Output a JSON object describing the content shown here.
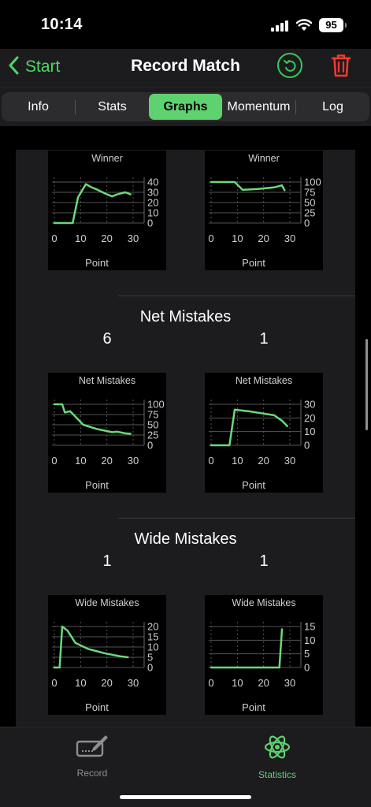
{
  "status": {
    "time": "10:14",
    "battery": "95"
  },
  "nav": {
    "back_label": "Start",
    "title": "Record Match"
  },
  "tabs": [
    {
      "label": "Info",
      "selected": false
    },
    {
      "label": "Stats",
      "selected": false
    },
    {
      "label": "Graphs",
      "selected": true
    },
    {
      "label": "Momentum",
      "selected": false
    },
    {
      "label": "Log",
      "selected": false
    }
  ],
  "sections": [
    {
      "id": "winner",
      "title": "",
      "values": [
        "",
        ""
      ],
      "charts": [
        {
          "title": "Winner",
          "xlabel": "Point",
          "xticks": [
            0,
            10,
            20,
            30
          ],
          "yticks": [
            0,
            10,
            20,
            30,
            40
          ],
          "ymax": 40,
          "x": [
            0,
            7,
            9,
            12,
            14,
            16,
            20,
            22,
            24,
            27,
            29
          ],
          "y": [
            0,
            0,
            25,
            38,
            35,
            33,
            28,
            26,
            28,
            30,
            28
          ]
        },
        {
          "title": "Winner",
          "xlabel": "Point",
          "xticks": [
            0,
            10,
            20,
            30
          ],
          "yticks": [
            0,
            25,
            50,
            75,
            100
          ],
          "ymax": 100,
          "x": [
            0,
            6,
            9,
            12,
            18,
            24,
            27,
            28
          ],
          "y": [
            100,
            100,
            100,
            81,
            83,
            87,
            92,
            80
          ]
        }
      ]
    },
    {
      "id": "net-mistakes",
      "title": "Net Mistakes",
      "values": [
        "6",
        "1"
      ],
      "charts": [
        {
          "title": "Net Mistakes",
          "xlabel": "Point",
          "xticks": [
            0,
            10,
            20,
            30
          ],
          "yticks": [
            0,
            25,
            50,
            75,
            100
          ],
          "ymax": 100,
          "x": [
            0,
            3,
            4,
            6,
            8,
            11,
            16,
            22,
            24,
            27,
            29
          ],
          "y": [
            100,
            100,
            80,
            83,
            70,
            50,
            40,
            32,
            33,
            29,
            28
          ]
        },
        {
          "title": "Net Mistakes",
          "xlabel": "Point",
          "xticks": [
            0,
            10,
            20,
            30
          ],
          "yticks": [
            0,
            10,
            20,
            30
          ],
          "ymax": 30,
          "x": [
            0,
            7,
            9,
            14,
            24,
            27,
            29
          ],
          "y": [
            0,
            0,
            26,
            25,
            22,
            18,
            14
          ]
        }
      ]
    },
    {
      "id": "wide-mistakes",
      "title": "Wide Mistakes",
      "values": [
        "1",
        "1"
      ],
      "charts": [
        {
          "title": "Wide Mistakes",
          "xlabel": "Point",
          "xticks": [
            0,
            10,
            20,
            30
          ],
          "yticks": [
            0,
            5,
            10,
            15,
            20
          ],
          "ymax": 20,
          "x": [
            0,
            2,
            3,
            5,
            8,
            13,
            19,
            25,
            28
          ],
          "y": [
            0,
            0,
            20,
            18,
            12,
            9,
            7,
            5.5,
            5
          ]
        },
        {
          "title": "Wide Mistakes",
          "xlabel": "Point",
          "xticks": [
            0,
            10,
            20,
            30
          ],
          "yticks": [
            0,
            5,
            10,
            15
          ],
          "ymax": 15,
          "x": [
            0,
            5,
            10,
            15,
            20,
            26,
            27
          ],
          "y": [
            0,
            0,
            0,
            0,
            0,
            0,
            14
          ]
        }
      ]
    }
  ],
  "bottom_tabs": [
    {
      "label": "Record",
      "icon": "signature-pad-icon",
      "selected": false
    },
    {
      "label": "Statistics",
      "icon": "atom-icon",
      "selected": true
    }
  ],
  "colors": {
    "accent": "#5ed26f",
    "line": "#6bd97a",
    "trash": "#ff3b30",
    "inactive": "#8e8e93"
  }
}
